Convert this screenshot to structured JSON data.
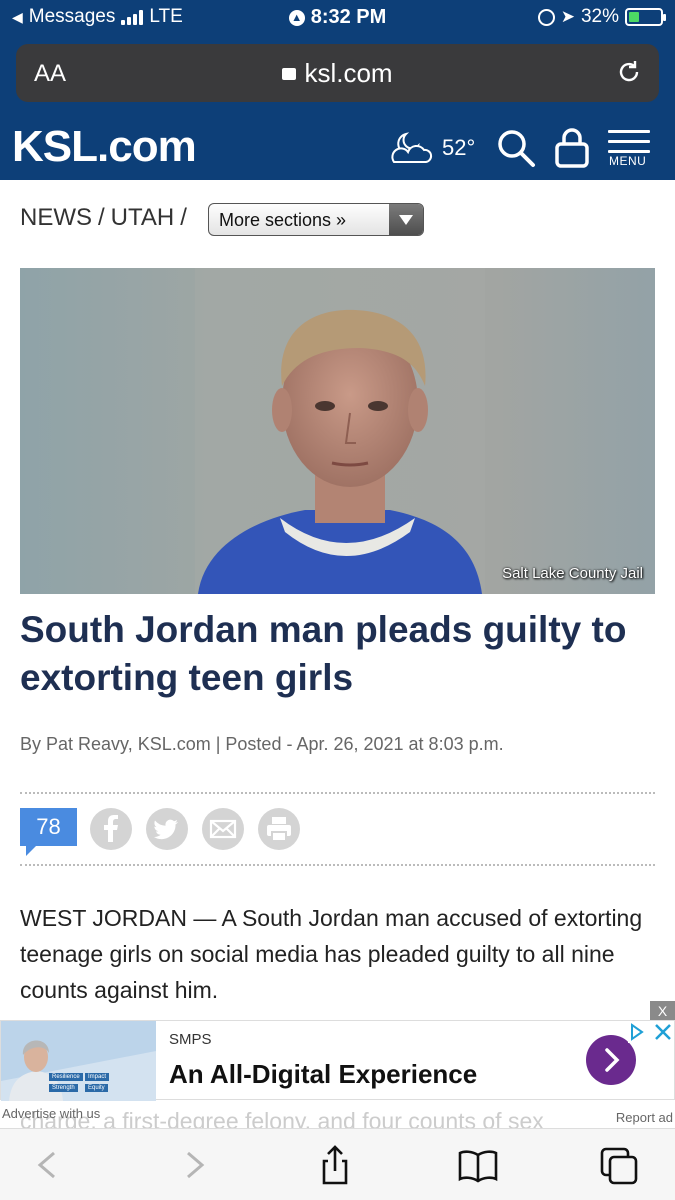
{
  "status_bar": {
    "back_app": "Messages",
    "network": "LTE",
    "time": "8:32 PM",
    "battery": "32%",
    "battery_level": 0.32
  },
  "browser": {
    "text_size_label": "AA",
    "url": "ksl.com"
  },
  "site_header": {
    "logo": "KSL.com",
    "temperature": "52°",
    "menu_label": "MENU"
  },
  "breadcrumb": {
    "items": [
      "NEWS",
      "/",
      "UTAH",
      "/"
    ],
    "sections_label": "More sections »"
  },
  "article": {
    "photo_credit": "Salt Lake County Jail",
    "headline": "South Jordan man pleads guilty to extorting teen girls",
    "byline": "By Pat Reavy, KSL.com | Posted - Apr. 26, 2021 at 8:03 p.m.",
    "comment_count": "78",
    "body": "WEST JORDAN — A South Jordan man accused of extorting teenage girls on social media has pleaded guilty to all nine counts against him.",
    "obscured_text": "charge, a first-degree felony, and four counts of sex"
  },
  "ad": {
    "close_label": "X",
    "sponsor": "SMPS",
    "headline": "An All-Digital Experience",
    "image_tags": [
      "Resilience",
      "Impact",
      "Strength",
      "Equity"
    ],
    "advertise_label": "Advertise with us",
    "report_label": "Report ad"
  },
  "colors": {
    "brand_navy": "#0d3f78",
    "headline": "#1e2f52",
    "comment_badge": "#4a8be0",
    "ad_arrow": "#6a2a8e"
  }
}
